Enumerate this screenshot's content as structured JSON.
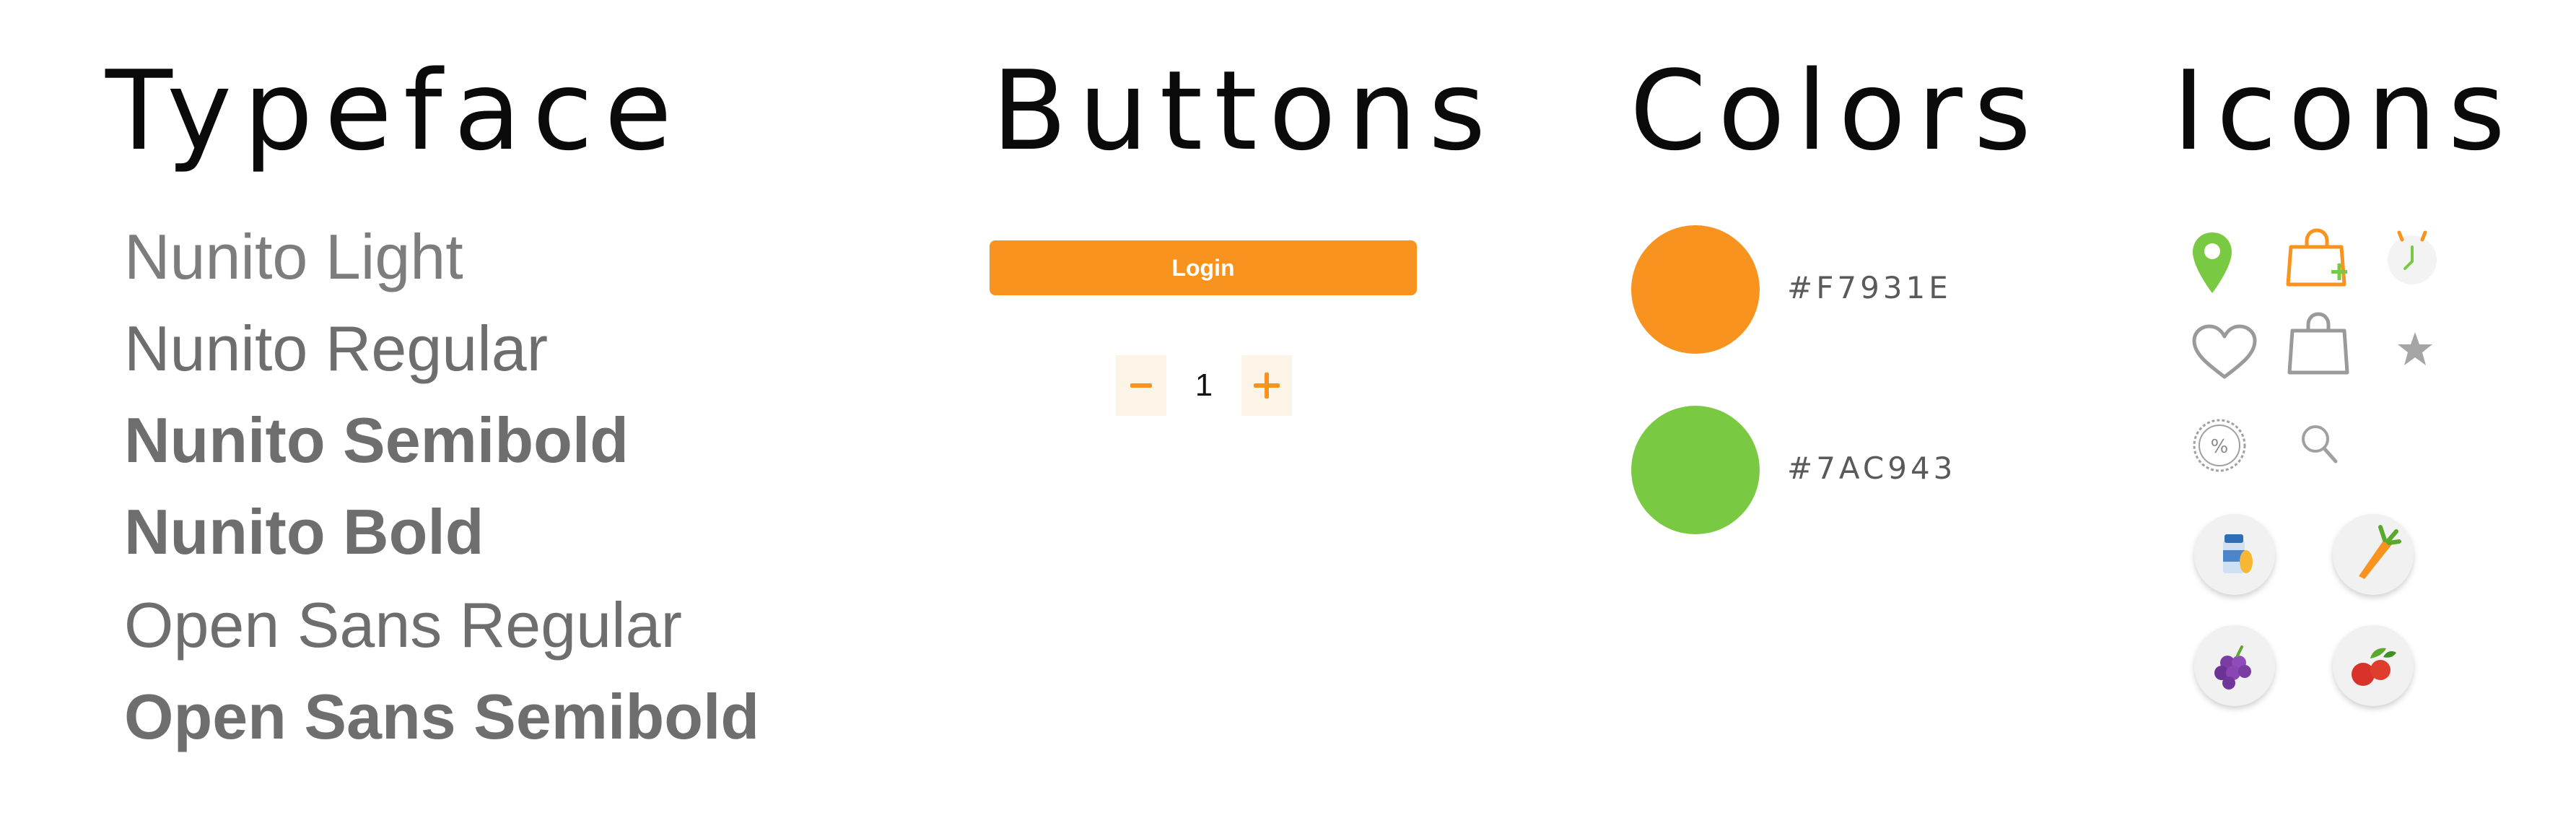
{
  "sections": {
    "typeface": "Typeface",
    "buttons": "Buttons",
    "colors": "Colors",
    "icons": "Icons"
  },
  "typeface_samples": [
    "Nunito Light",
    "Nunito Regular",
    "Nunito Semibold",
    "Nunito Bold",
    "Open Sans Regular",
    "Open Sans Semibold"
  ],
  "buttons": {
    "login_label": "Login",
    "stepper": {
      "minus": "−",
      "value": "1",
      "plus": "+"
    }
  },
  "colors": [
    {
      "hex": "#F7931E",
      "label": "#F7931E"
    },
    {
      "hex": "#7AC943",
      "label": "#7AC943"
    }
  ],
  "icons": [
    "location-pin-icon",
    "shopping-bag-add-icon",
    "clock-icon",
    "heart-icon",
    "shopping-bag-icon",
    "star-icon",
    "discount-badge-icon",
    "search-icon",
    "milk-bottle-icon",
    "carrot-icon",
    "grapes-icon",
    "fruits-icon"
  ]
}
